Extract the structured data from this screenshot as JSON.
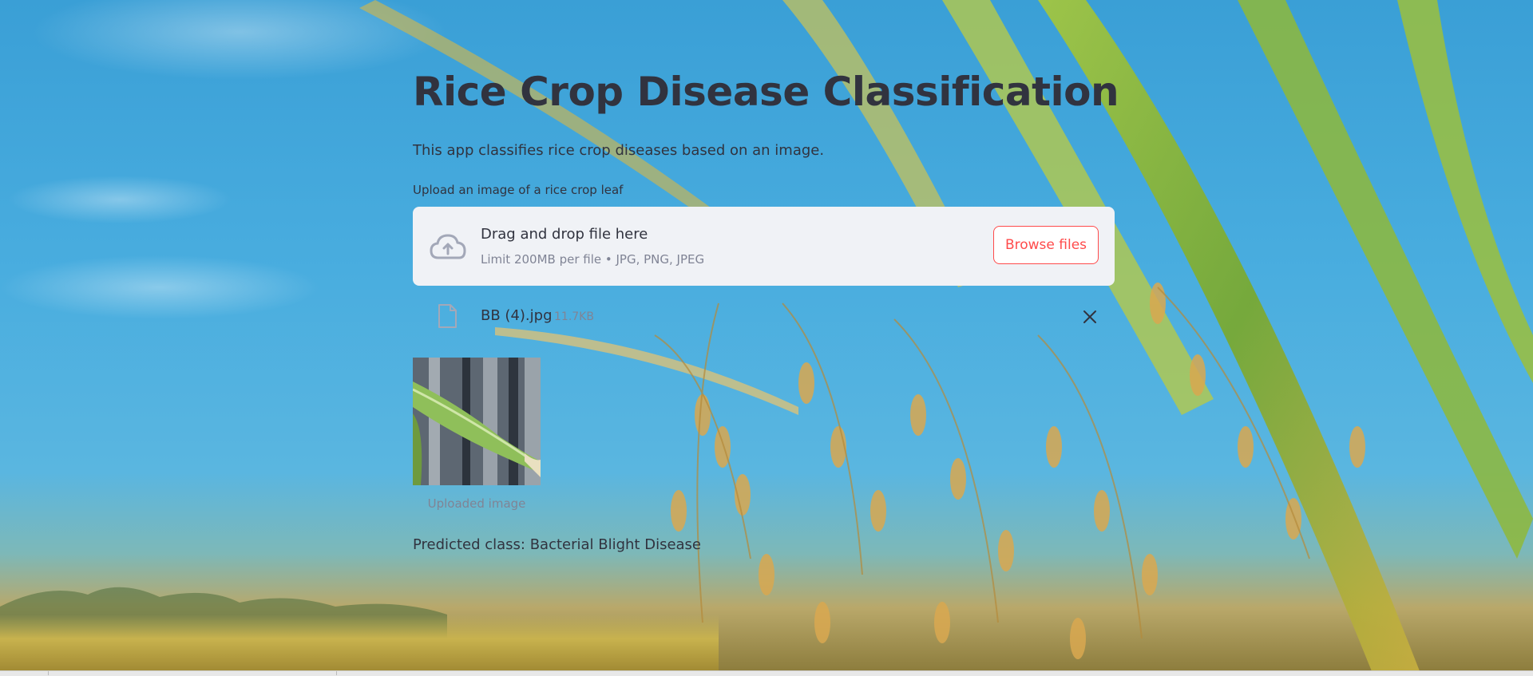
{
  "app": {
    "title": "Rice Crop Disease Classification",
    "description": "This app classifies rice crop diseases based on an image."
  },
  "uploader": {
    "label": "Upload an image of a rice crop leaf",
    "dropzone_title": "Drag and drop file here",
    "dropzone_hint": "Limit 200MB per file • JPG, PNG, JPEG",
    "browse_label": "Browse files",
    "icon": "cloud-upload-icon"
  },
  "uploaded_file": {
    "name": "BB (4).jpg",
    "size": "11.7KB",
    "icon": "file-icon",
    "remove_icon": "close-icon"
  },
  "image": {
    "caption": "Uploaded image"
  },
  "result": {
    "prediction": "Predicted class: Bacterial Blight Disease"
  },
  "colors": {
    "text": "#31333f",
    "muted": "#808495",
    "accent": "#ff4b4b",
    "dropzone_bg": "#f0f2f6",
    "sky": "#49addf"
  }
}
